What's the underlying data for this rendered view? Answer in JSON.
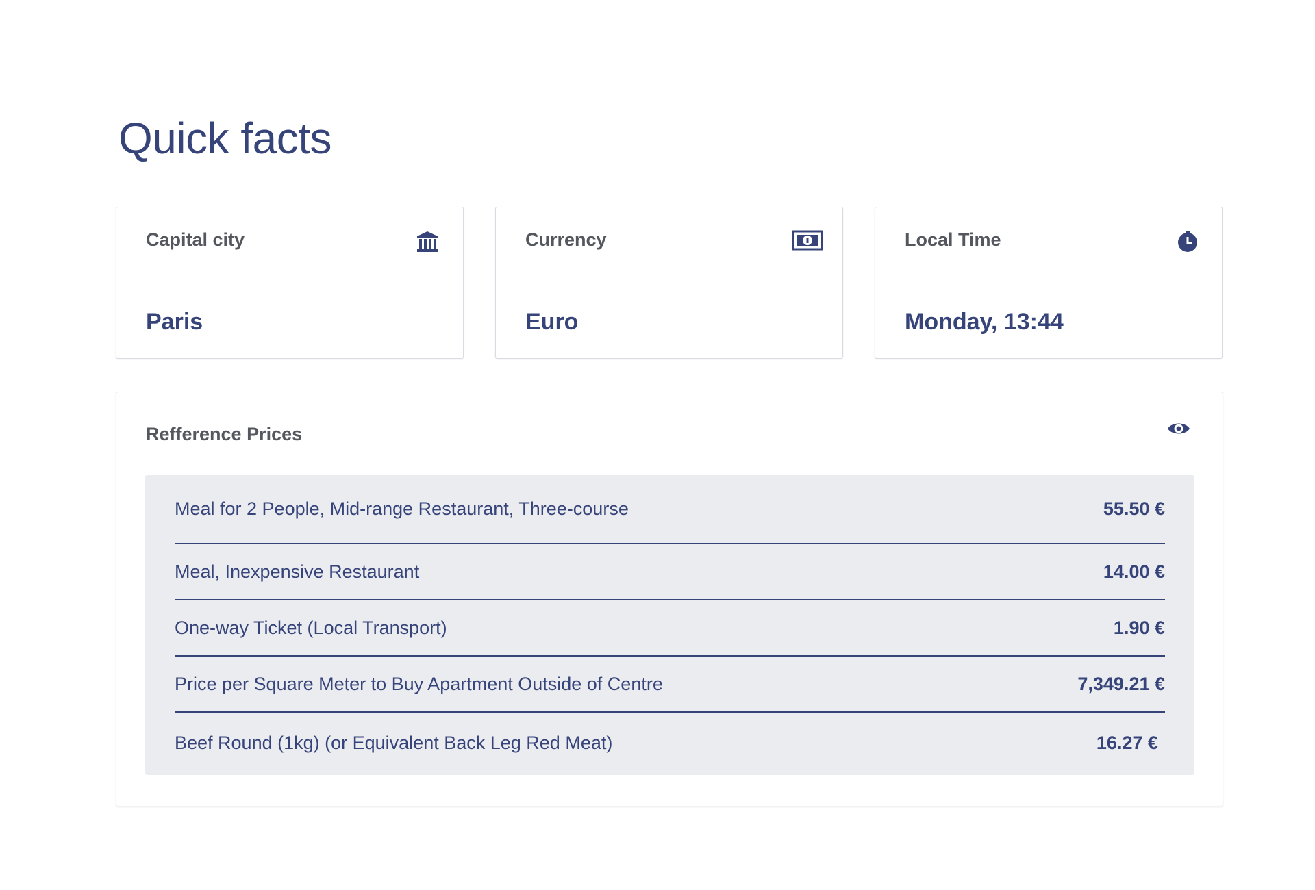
{
  "page": {
    "title": "Quick facts"
  },
  "cards": [
    {
      "label": "Capital city",
      "value": "Paris",
      "icon": "museum-icon"
    },
    {
      "label": "Currency",
      "value": "Euro",
      "icon": "banknote-icon"
    },
    {
      "label": "Local Time",
      "value": "Monday, 13:44",
      "icon": "clock-icon"
    }
  ],
  "prices": {
    "title": "Refference Prices",
    "icon": "eye-icon",
    "rows": [
      {
        "name": "Meal for 2 People, Mid-range Restaurant, Three-course",
        "value": "55.50 €"
      },
      {
        "name": "Meal, Inexpensive Restaurant",
        "value": "14.00 €"
      },
      {
        "name": "One-way Ticket (Local Transport)",
        "value": "1.90 €"
      },
      {
        "name": "Price per Square Meter to Buy Apartment Outside of Centre",
        "value": "7,349.21 €"
      },
      {
        "name": "Beef Round (1kg) (or Equivalent Back Leg Red Meat)",
        "value": "16.27 €"
      }
    ]
  },
  "colors": {
    "accent": "#36447a",
    "label_text": "#54575d",
    "table_background": "#ebecf0",
    "card_border": "#d9dbe1"
  }
}
